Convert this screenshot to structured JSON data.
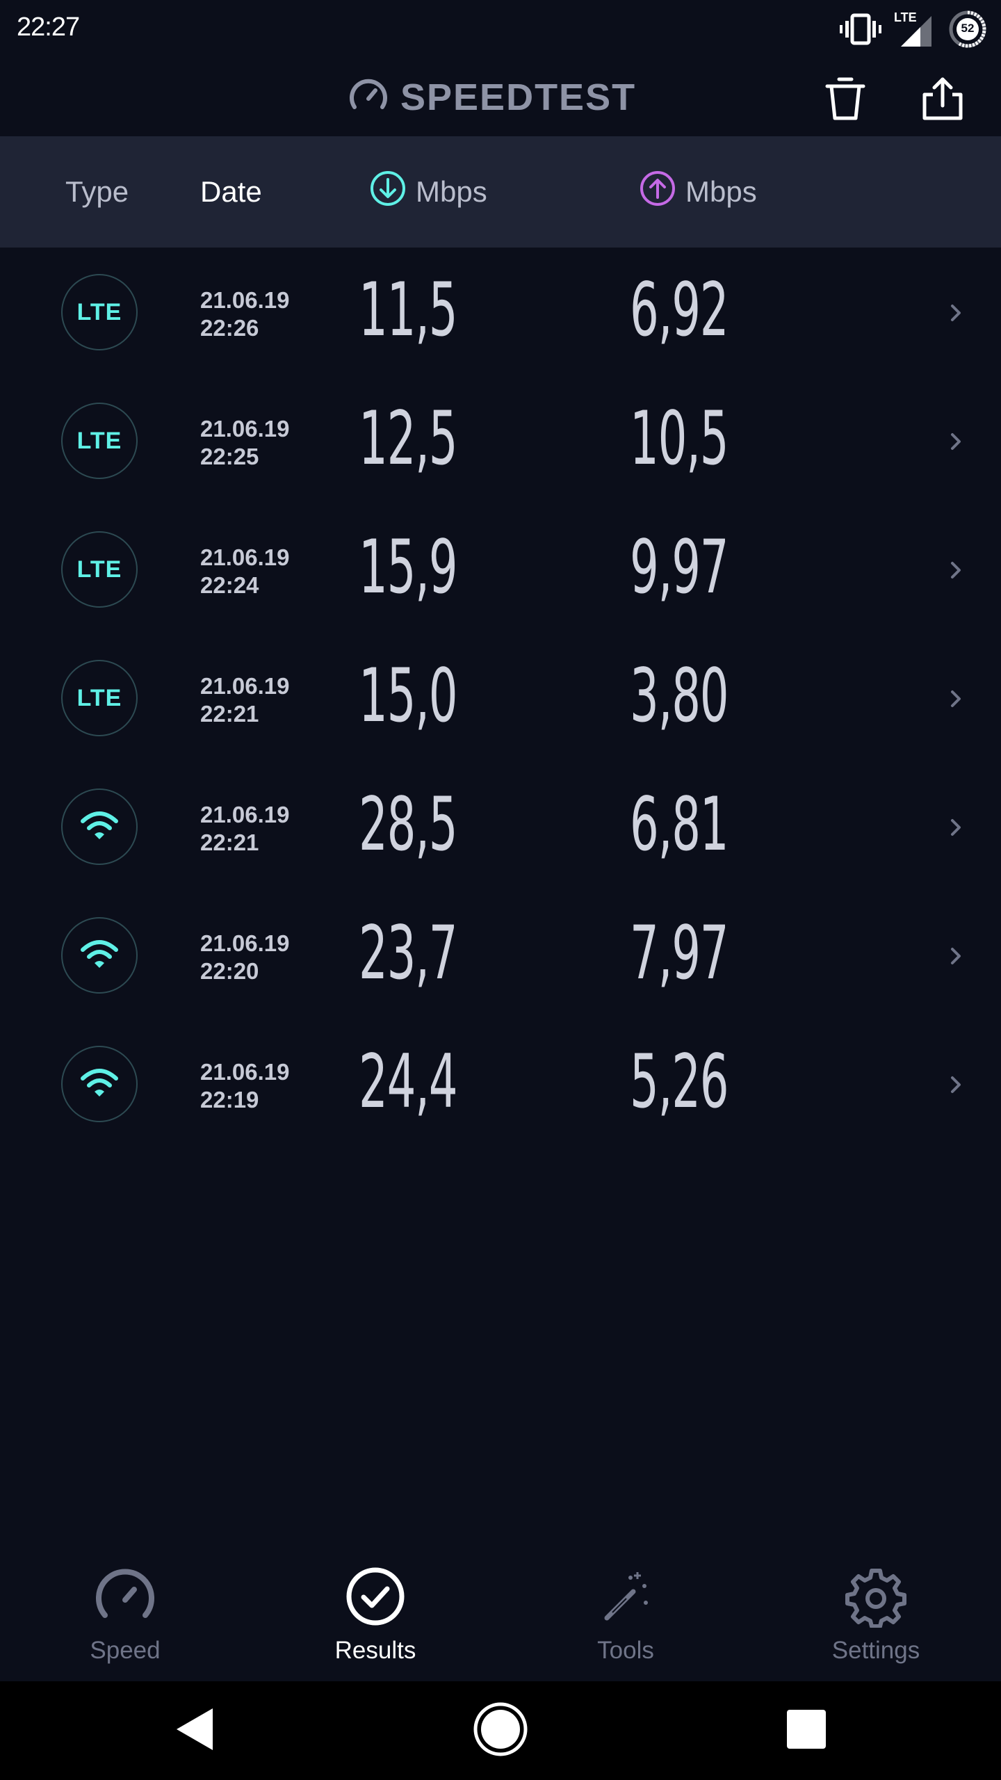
{
  "status_bar": {
    "time": "22:27",
    "network_label": "LTE",
    "battery_level": "52",
    "icons": [
      "vibrate-icon",
      "signal-icon",
      "battery-icon"
    ]
  },
  "app_bar": {
    "title": "SPEEDTEST",
    "icons": [
      "speedometer-icon",
      "trash-icon",
      "share-icon"
    ]
  },
  "table_header": {
    "type_label": "Type",
    "date_label": "Date",
    "download_label": "Mbps",
    "upload_label": "Mbps"
  },
  "results": [
    {
      "type": "LTE",
      "date": "21.06.19",
      "time": "22:26",
      "download": "11,5",
      "upload": "6,92"
    },
    {
      "type": "LTE",
      "date": "21.06.19",
      "time": "22:25",
      "download": "12,5",
      "upload": "10,5"
    },
    {
      "type": "LTE",
      "date": "21.06.19",
      "time": "22:24",
      "download": "15,9",
      "upload": "9,97"
    },
    {
      "type": "LTE",
      "date": "21.06.19",
      "time": "22:21",
      "download": "15,0",
      "upload": "3,80"
    },
    {
      "type": "wifi",
      "date": "21.06.19",
      "time": "22:21",
      "download": "28,5",
      "upload": "6,81"
    },
    {
      "type": "wifi",
      "date": "21.06.19",
      "time": "22:20",
      "download": "23,7",
      "upload": "7,97"
    },
    {
      "type": "wifi",
      "date": "21.06.19",
      "time": "22:19",
      "download": "24,4",
      "upload": "5,26"
    }
  ],
  "bottom_nav": {
    "items": [
      {
        "label": "Speed",
        "icon": "speedometer-icon",
        "active": false
      },
      {
        "label": "Results",
        "icon": "check-circle-icon",
        "active": true
      },
      {
        "label": "Tools",
        "icon": "magic-wand-icon",
        "active": false
      },
      {
        "label": "Settings",
        "icon": "gear-icon",
        "active": false
      }
    ]
  },
  "colors": {
    "background": "#0b0e1a",
    "header_background": "#1f2435",
    "accent_download": "#5ff0e6",
    "accent_upload": "#c56ae6",
    "muted_text": "#6f7488"
  }
}
